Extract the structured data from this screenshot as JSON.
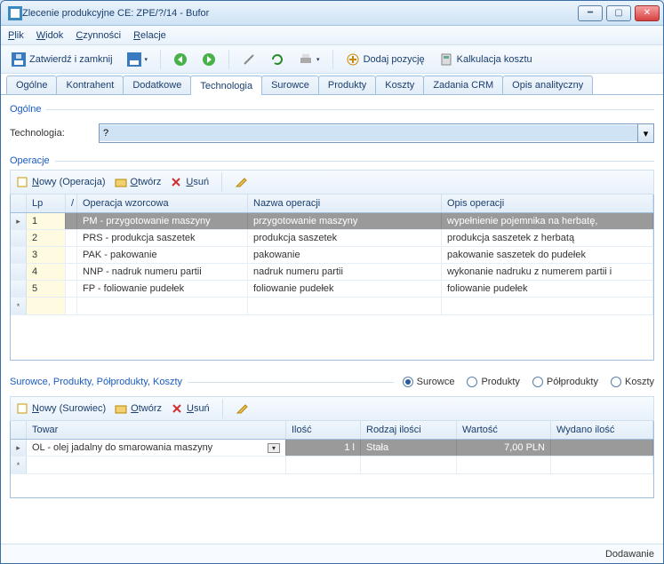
{
  "window": {
    "title": "Zlecenie produkcyjne CE: ZPE/?/14 - Bufor"
  },
  "menu": {
    "plik": "Plik",
    "widok": "Widok",
    "czynnosci": "Czynności",
    "relacje": "Relacje"
  },
  "toolbar": {
    "zatwierdz": "Zatwierdź i zamknij",
    "dodaj": "Dodaj pozycję",
    "kalk": "Kalkulacja kosztu"
  },
  "tabs": [
    "Ogólne",
    "Kontrahent",
    "Dodatkowe",
    "Technologia",
    "Surowce",
    "Produkty",
    "Koszty",
    "Zadania CRM",
    "Opis analityczny"
  ],
  "activeTab": "Technologia",
  "group": {
    "ogolne": "Ogólne",
    "operacje": "Operacje",
    "surowce_etc": "Surowce, Produkty, Półprodukty, Koszty"
  },
  "fields": {
    "technologia_label": "Technologia:",
    "technologia_value": "?"
  },
  "opToolbar": {
    "nowy": "Nowy (Operacja)",
    "otworz": "Otwórz",
    "usun": "Usuń"
  },
  "opGrid": {
    "headers": {
      "lp": "Lp",
      "wz": "Operacja wzorcowa",
      "nazwa": "Nazwa operacji",
      "opis": "Opis operacji"
    },
    "rows": [
      {
        "lp": "1",
        "wz": "PM - przygotowanie maszyny",
        "nazwa": "przygotowanie maszyny",
        "opis": "wypełnienie pojemnika na herbatę,"
      },
      {
        "lp": "2",
        "wz": "PRS - produkcja saszetek",
        "nazwa": "produkcja saszetek",
        "opis": "produkcja saszetek z herbatą"
      },
      {
        "lp": "3",
        "wz": "PAK - pakowanie",
        "nazwa": "pakowanie",
        "opis": "pakowanie saszetek do pudełek"
      },
      {
        "lp": "4",
        "wz": "NNP - nadruk numeru partii",
        "nazwa": "nadruk numeru partii",
        "opis": "wykonanie nadruku z numerem partii i"
      },
      {
        "lp": "5",
        "wz": "FP - foliowanie pudełek",
        "nazwa": "foliowanie pudełek",
        "opis": "foliowanie pudełek"
      }
    ]
  },
  "radios": {
    "surowce": "Surowce",
    "produkty": "Produkty",
    "polprodukty": "Półprodukty",
    "koszty": "Koszty"
  },
  "surToolbar": {
    "nowy": "Nowy (Surowiec)",
    "otworz": "Otwórz",
    "usun": "Usuń"
  },
  "surGrid": {
    "headers": {
      "towar": "Towar",
      "ilosc": "Ilość",
      "rodzaj": "Rodzaj ilości",
      "wartosc": "Wartość",
      "wydano": "Wydano ilość"
    },
    "rows": [
      {
        "towar": "OL - olej jadalny do smarowania maszyny",
        "ilosc": "1 l",
        "rodzaj": "Stała",
        "wartosc": "7,00 PLN",
        "wydano": ""
      }
    ]
  },
  "status": "Dodawanie"
}
